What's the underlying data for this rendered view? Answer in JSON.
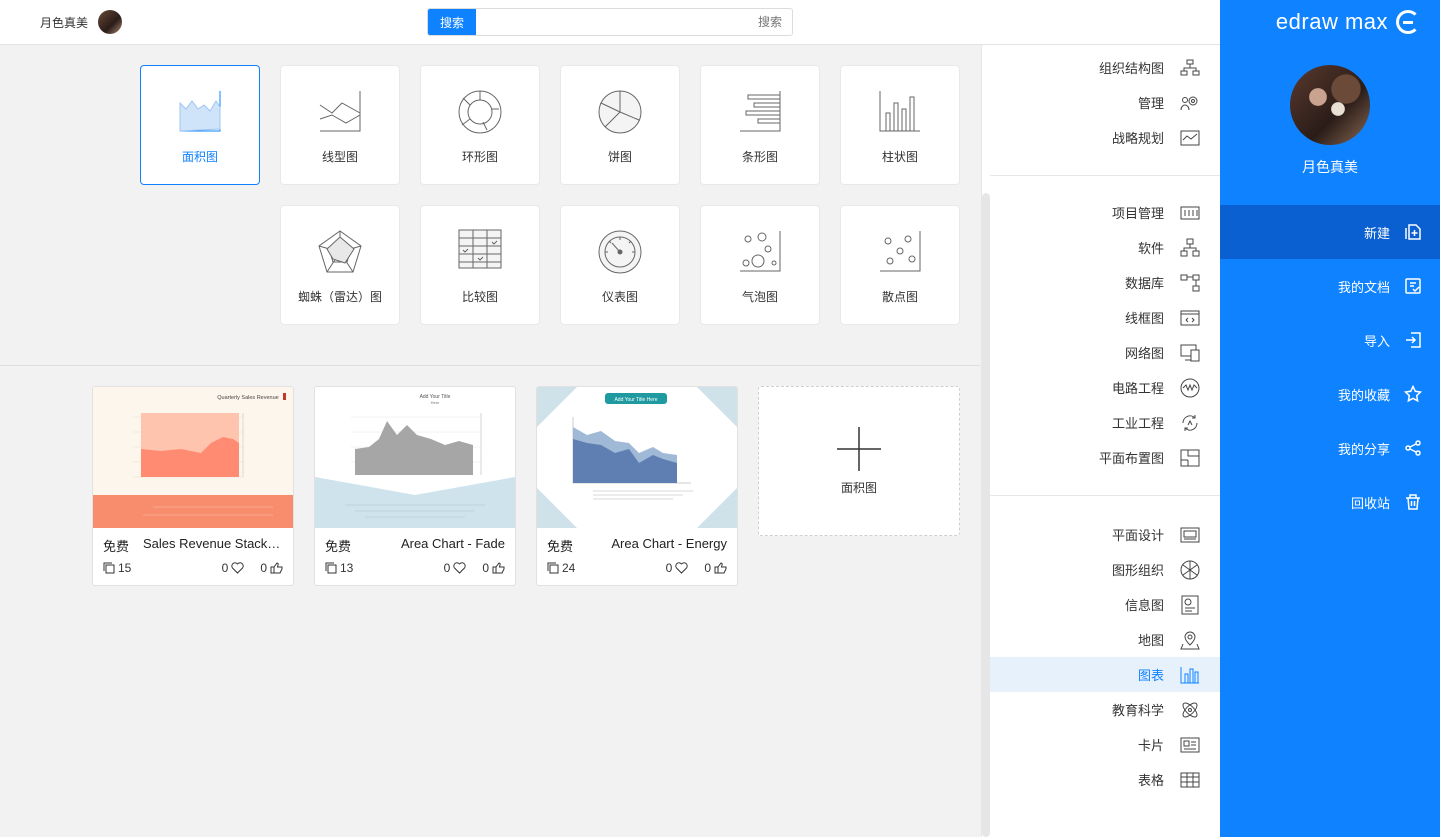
{
  "app": {
    "logo_text": "edraw max"
  },
  "user": {
    "name": "月色真美"
  },
  "topbar": {
    "search_button": "搜索",
    "search_placeholder": "搜索",
    "user_name": "月色真美"
  },
  "sidebar": {
    "items": [
      {
        "label": "新建",
        "icon": "new-file-icon",
        "active": true
      },
      {
        "label": "我的文档",
        "icon": "document-icon"
      },
      {
        "label": "导入",
        "icon": "import-icon"
      },
      {
        "label": "我的收藏",
        "icon": "star-icon"
      },
      {
        "label": "我的分享",
        "icon": "share-icon"
      },
      {
        "label": "回收站",
        "icon": "trash-icon"
      }
    ]
  },
  "categories": {
    "group1": [
      "组织结构图",
      "管理",
      "战略规划"
    ],
    "group2": [
      "项目管理",
      "软件",
      "数据库",
      "线框图",
      "网络图",
      "电路工程",
      "工业工程",
      "平面布置图"
    ],
    "group3": [
      "平面设计",
      "图形组织",
      "信息图",
      "地图",
      "图表",
      "教育科学",
      "卡片",
      "表格"
    ],
    "active": "图表"
  },
  "chart_types": [
    {
      "label": "柱状图",
      "icon": "bar-chart-icon"
    },
    {
      "label": "条形图",
      "icon": "horizontal-bar-icon"
    },
    {
      "label": "饼图",
      "icon": "pie-chart-icon"
    },
    {
      "label": "环形图",
      "icon": "donut-chart-icon"
    },
    {
      "label": "线型图",
      "icon": "line-chart-icon"
    },
    {
      "label": "面积图",
      "icon": "area-chart-icon",
      "selected": true
    },
    {
      "label": "散点图",
      "icon": "scatter-icon"
    },
    {
      "label": "气泡图",
      "icon": "bubble-icon"
    },
    {
      "label": "仪表图",
      "icon": "gauge-icon"
    },
    {
      "label": "比较图",
      "icon": "comparison-table-icon"
    },
    {
      "label": "蜘蛛（雷达）图",
      "icon": "radar-icon"
    }
  ],
  "new_card": {
    "label": "面积图"
  },
  "templates": [
    {
      "title": "Area Chart - Energy",
      "price": "免费",
      "likes": "0",
      "favorites": "0",
      "copies": "24"
    },
    {
      "title": "Area Chart - Fade",
      "price": "免费",
      "likes": "0",
      "favorites": "0",
      "copies": "13"
    },
    {
      "title": "Sales Revenue Stacke...",
      "price": "免费",
      "likes": "0",
      "favorites": "0",
      "copies": "15"
    }
  ],
  "thumbs": {
    "energy_title": "Add Your Title Here",
    "fade_title": "Add Your Title",
    "fade_subtitle": "Here",
    "sales_title": "Quarterly Sales Revenue"
  },
  "colors": {
    "accent": "#0f82ff",
    "sidebar_active": "#0a5fd1",
    "category_active_bg": "#e6f1fc"
  }
}
